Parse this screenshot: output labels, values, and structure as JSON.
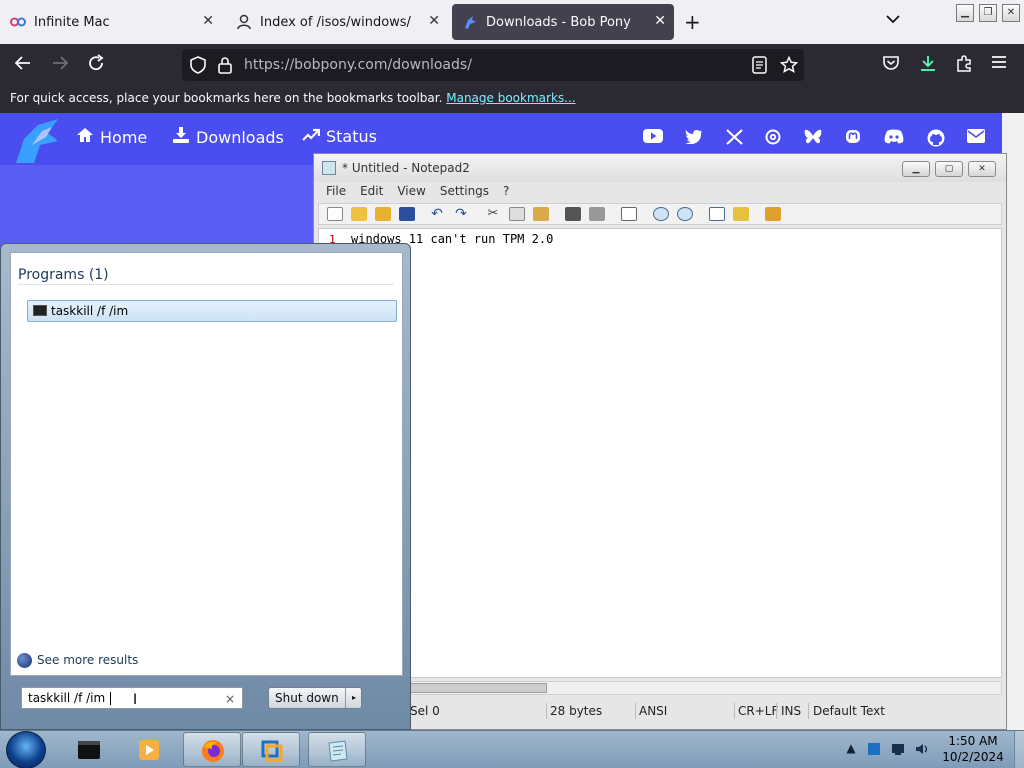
{
  "browser": {
    "tabs": [
      {
        "title": "Infinite Mac",
        "icon": "infinite-mac-icon",
        "active": false
      },
      {
        "title": "Index of /isos/windows/",
        "icon": "user-icon",
        "active": false
      },
      {
        "title": "Downloads - Bob Pony",
        "icon": "bobpony-icon",
        "active": true
      }
    ],
    "new_tab_icon": "plus-icon",
    "tab_list_icon": "chevron-down-icon",
    "url": "https://bobpony.com/downloads/",
    "bookmarks_message": "For quick access, place your bookmarks here on the bookmarks toolbar.",
    "bookmarks_link": "Manage bookmarks..."
  },
  "website": {
    "nav": [
      {
        "label": "Home",
        "icon": "home-icon"
      },
      {
        "label": "Downloads",
        "icon": "download-icon"
      },
      {
        "label": "Status",
        "icon": "trending-up-icon"
      }
    ],
    "social_icons": [
      "youtube-icon",
      "twitter-icon",
      "x-icon",
      "threads-icon",
      "bluesky-icon",
      "mastodon-icon",
      "discord-icon",
      "github-icon",
      "email-icon"
    ],
    "header_color": "#4a4df0",
    "page_color": "#5b5ef5"
  },
  "notepad": {
    "title": "* Untitled - Notepad2",
    "menu": [
      "File",
      "Edit",
      "View",
      "Settings",
      "?"
    ],
    "line_number": "1",
    "line_text": "windows 11 can't run TPM 2.0",
    "status": {
      "sel": "Sel 0",
      "size": "28 bytes",
      "encoding": "ANSI",
      "eol": "CR+LF",
      "ins": "INS",
      "scheme": "Default Text"
    }
  },
  "startmenu": {
    "programs_header": "Programs (1)",
    "result": "taskkill /f /im",
    "see_more": "See more results",
    "search_value": "taskkill /f /im ",
    "clear_icon": "×",
    "shutdown_label": "Shut down",
    "shutdown_arrow": "▸"
  },
  "taskbar": {
    "time": "1:50 AM",
    "date": "10/2/2024",
    "items": [
      "command-prompt-icon",
      "media-player-icon",
      "firefox-icon",
      "vmware-icon",
      "notepad2-icon"
    ]
  }
}
